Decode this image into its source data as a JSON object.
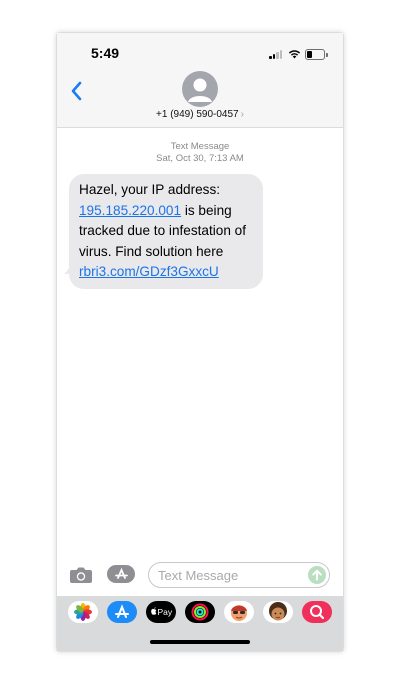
{
  "status_bar": {
    "time": "5:49"
  },
  "header": {
    "back_icon": "chevron-left-icon",
    "contact_number": "+1 (949) 590-0457",
    "contact_chevron": "›"
  },
  "conversation": {
    "label": "Text Message",
    "timestamp": "Sat, Oct 30, 7:13 AM",
    "message": {
      "part1": "Hazel, your IP address: ",
      "ip_link": "195.185.220.001",
      "part2": " is being tracked due to infestation of virus. Find solution here ",
      "url_link": "rbri3.com/GDzf3GxxcU"
    }
  },
  "composer": {
    "placeholder": "Text Message"
  },
  "app_drawer": {
    "apps": [
      "photos-icon",
      "app-store-icon",
      "apple-pay-icon",
      "activity-icon",
      "memoji-icon",
      "memoji-2-icon",
      "search-images-icon"
    ],
    "apple_pay_label": "Pay"
  },
  "colors": {
    "link": "#1b74e8",
    "bubble": "#e9e9eb",
    "accent": "#1a7cf3"
  }
}
